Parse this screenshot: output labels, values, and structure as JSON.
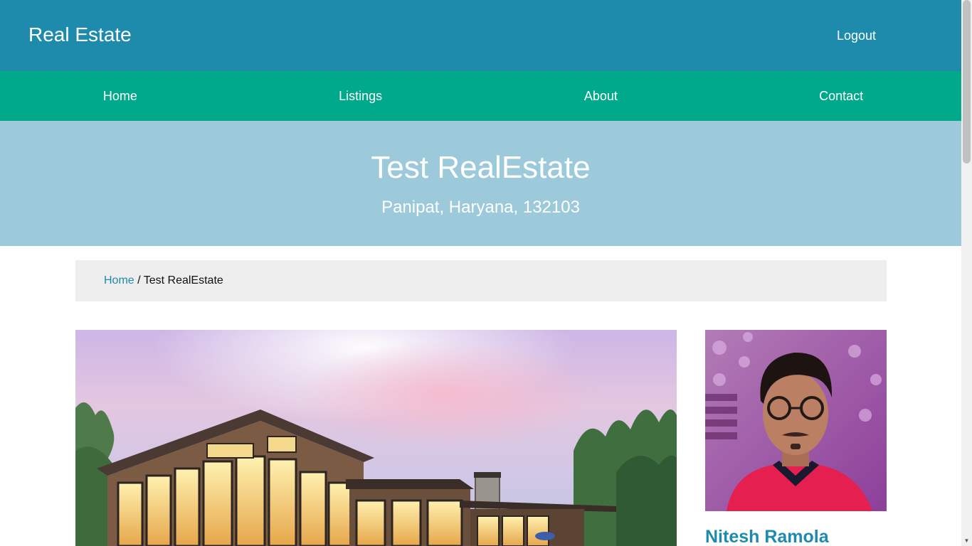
{
  "header": {
    "brand": "Real Estate",
    "logout_label": "Logout",
    "bg_color": "#1e8bad"
  },
  "nav": {
    "items": [
      {
        "label": "Home"
      },
      {
        "label": "Listings"
      },
      {
        "label": "About"
      },
      {
        "label": "Contact"
      }
    ],
    "bg_color": "#00a98a"
  },
  "hero": {
    "title": "Test RealEstate",
    "subtitle": "Panipat, Haryana, 132103",
    "bg_color": "#9ccadb"
  },
  "breadcrumb": {
    "home_label": "Home",
    "separator": " / ",
    "current": "Test RealEstate"
  },
  "listing": {
    "main_image_icon": "house-photo"
  },
  "realtor": {
    "name": "Nitesh Ramola",
    "photo_icon": "realtor-portrait"
  },
  "colors": {
    "accent": "#1e8bad",
    "breadcrumb_bg": "#eeeeee"
  }
}
